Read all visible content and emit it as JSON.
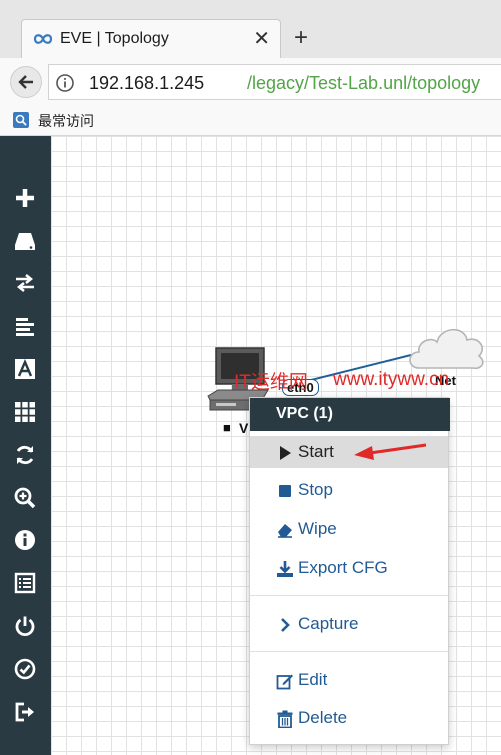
{
  "browser": {
    "tab_title": "EVE | Topology",
    "tab_close": "✕",
    "new_tab": "+",
    "url_host": "192.168.1.245",
    "url_path": "/legacy/Test-Lab.unl/topology",
    "bookmark_label": "最常访问"
  },
  "sidebar": {
    "icons": [
      "add-icon",
      "node-icon",
      "network-icon",
      "list-icon",
      "text-icon",
      "grid-icon",
      "refresh-icon",
      "zoom-icon",
      "info-icon",
      "lab-details-icon",
      "power-icon",
      "check-icon",
      "logout-icon"
    ]
  },
  "topology": {
    "node_label": "VI",
    "node_status_mark": "■",
    "interface_label": "eth0",
    "cloud_label": "Net",
    "link_color": "#1f5f99"
  },
  "watermark": {
    "text_cn": "IT运维网",
    "text_url": "www.ityww.cn"
  },
  "context_menu": {
    "title": "VPC (1)",
    "items": [
      {
        "label": "Start",
        "icon": "play-icon"
      },
      {
        "label": "Stop",
        "icon": "stop-icon"
      },
      {
        "label": "Wipe",
        "icon": "eraser-icon"
      },
      {
        "label": "Export CFG",
        "icon": "download-icon"
      },
      {
        "label": "Capture",
        "icon": "chevron-right-icon"
      },
      {
        "label": "Edit",
        "icon": "edit-icon"
      },
      {
        "label": "Delete",
        "icon": "trash-icon"
      }
    ]
  },
  "colors": {
    "sidebar_bg": "#2a3a42",
    "menu_link": "#225b93",
    "url_path": "#52a447",
    "annotation_arrow": "#e02a2a"
  }
}
